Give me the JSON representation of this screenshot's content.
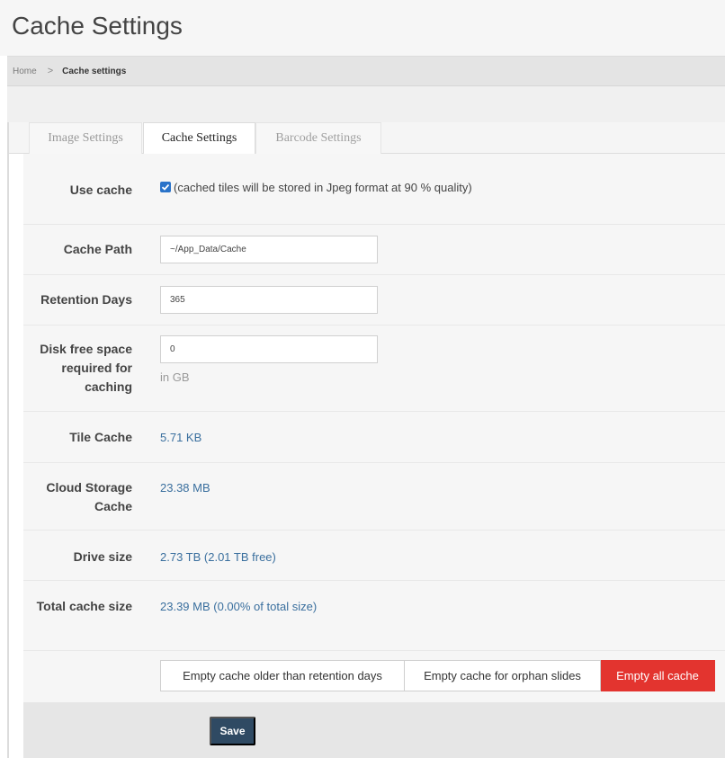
{
  "page": {
    "title": "Cache Settings"
  },
  "breadcrumb": {
    "home": "Home",
    "separator": ">",
    "current": "Cache settings"
  },
  "tabs": [
    {
      "label": "Image Settings",
      "active": false
    },
    {
      "label": "Cache Settings",
      "active": true
    },
    {
      "label": "Barcode Settings",
      "active": false
    }
  ],
  "form": {
    "use_cache": {
      "label": "Use cache",
      "checked": true,
      "description": "(cached tiles will be stored in Jpeg format at 90 % quality)"
    },
    "cache_path": {
      "label": "Cache Path",
      "value": "~/App_Data/Cache"
    },
    "retention_days": {
      "label": "Retention Days",
      "value": "365"
    },
    "disk_free_space": {
      "label": "Disk free space required for caching",
      "value": "0",
      "hint": "in GB"
    },
    "tile_cache": {
      "label": "Tile Cache",
      "value": "5.71 KB"
    },
    "cloud_storage_cache": {
      "label": "Cloud Storage Cache",
      "value": "23.38 MB"
    },
    "drive_size": {
      "label": "Drive size",
      "value": "2.73 TB (2.01 TB free)"
    },
    "total_cache_size": {
      "label": "Total cache size",
      "value": "23.39 MB (0.00% of total size)"
    }
  },
  "actions": {
    "empty_older": "Empty cache older than retention days",
    "empty_orphan": "Empty cache for orphan slides",
    "empty_all": "Empty all cache",
    "save": "Save"
  },
  "colors": {
    "link_value": "#3a6f9e",
    "danger": "#e3342f",
    "save_button": "#2f4a63",
    "checkbox": "#2a73c9"
  }
}
